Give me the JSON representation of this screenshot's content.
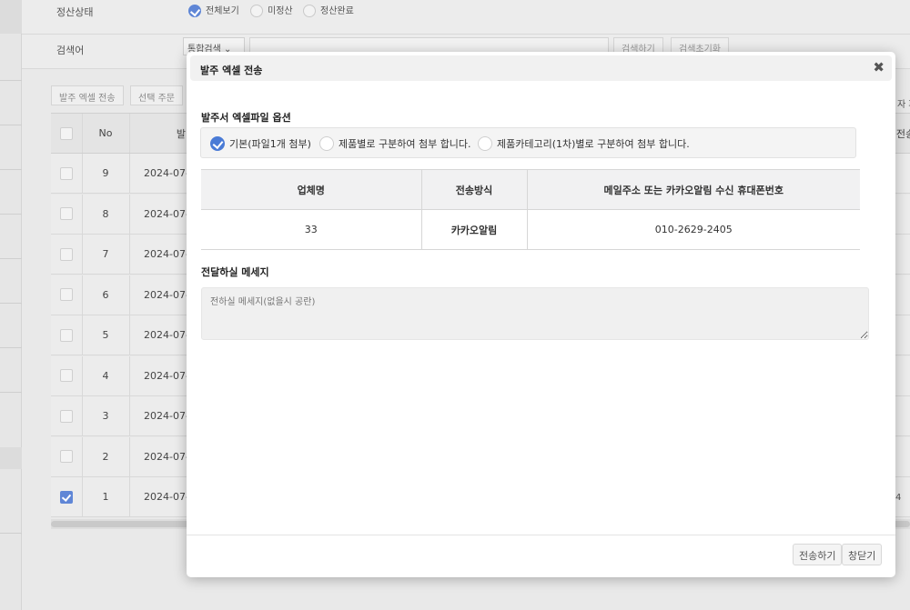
{
  "background": {
    "filter": {
      "status_label": "정산상태",
      "status_options": [
        "전체보기",
        "미정산",
        "정산완료"
      ],
      "status_selected": "전체보기",
      "search_label": "검색어",
      "search_type": "통합검색",
      "search_button": "검색하기",
      "reset_button": "검색초기화"
    },
    "toolbar": {
      "excel_send": "발주 엑셀 전송",
      "selected_order": "선택 주문"
    },
    "grid": {
      "head_no": "No",
      "head_partial": "발",
      "rows": [
        {
          "no": "9",
          "date": "2024-07-",
          "checked": false
        },
        {
          "no": "8",
          "date": "2024-07-",
          "checked": false
        },
        {
          "no": "7",
          "date": "2024-07-",
          "checked": false
        },
        {
          "no": "6",
          "date": "2024-07-",
          "checked": false
        },
        {
          "no": "5",
          "date": "2024-07-",
          "checked": false
        },
        {
          "no": "4",
          "date": "2024-07-",
          "checked": false
        },
        {
          "no": "3",
          "date": "2024-07-",
          "checked": false
        },
        {
          "no": "2",
          "date": "2024-07-",
          "checked": false
        },
        {
          "no": "1",
          "date": "2024-07-",
          "checked": true
        }
      ]
    },
    "right_edge": {
      "top": "자 파",
      "head": "전송",
      "last_row": "4"
    }
  },
  "modal": {
    "title": "발주 엑셀 전송",
    "close_glyph": "✖",
    "options_title": "발주서 엑셀파일 옵션",
    "options": [
      {
        "label": "기본(파일1개 첨부)",
        "selected": true
      },
      {
        "label": "제품별로 구분하여 첨부 합니다.",
        "selected": false
      },
      {
        "label": "제품카테고리(1차)별로 구분하여 첨부 합니다.",
        "selected": false
      }
    ],
    "table": {
      "headers": [
        "업체명",
        "전송방식",
        "메일주소 또는 카카오알림 수신 휴대폰번호"
      ],
      "rows": [
        [
          "33",
          "카카오알림",
          "010-2629-2405"
        ]
      ]
    },
    "message_title": "전달하실 메세지",
    "message_placeholder": "전하실 메세지(없을시 공란)",
    "message_value": "",
    "send_button": "전송하기",
    "close_button": "창닫기"
  },
  "colors": {
    "accent": "#4a7bd6",
    "overlay_bg": "#e9e9e9",
    "modal_bg": "#ffffff"
  }
}
